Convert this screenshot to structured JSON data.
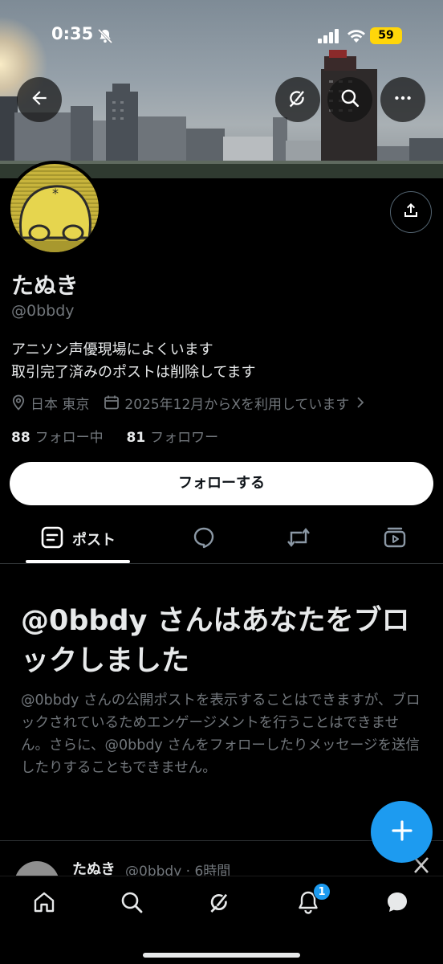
{
  "status_bar": {
    "time": "0:35",
    "battery": "59",
    "icons": [
      "bell-slash-icon",
      "signal-icon",
      "wifi-icon",
      "battery-icon"
    ]
  },
  "banner_buttons": [
    "back-arrow-icon",
    "grok-icon",
    "search-icon",
    "more-icon"
  ],
  "profile": {
    "display_name": "たぬき",
    "handle": "@0bbdy",
    "bio_lines": [
      "アニソン声優現場によくいます",
      "取引完了済みのポストは削除してます"
    ],
    "location": "日本 東京",
    "joined": "2025年12月からXを利用しています",
    "following_count": "88",
    "following_label": "フォロー中",
    "followers_count": "81",
    "followers_label": "フォロワー",
    "follow_button": "フォローする"
  },
  "tabs": [
    {
      "label": "ポスト",
      "icon": "post-icon",
      "active": true
    },
    {
      "label": "",
      "icon": "reply-icon",
      "active": false
    },
    {
      "label": "",
      "icon": "repost-icon",
      "active": false
    },
    {
      "label": "",
      "icon": "media-icon",
      "active": false
    }
  ],
  "blocked_notice": {
    "title": "@0bbdy さんはあなたをブロックしました",
    "description": "@0bbdy さんの公開ポストを表示することはできますが、ブロックされているためエンゲージメントを行うことはできません。さらに、@0bbdy さんをフォローしたりメッセージを送信したりすることもできません。"
  },
  "post_preview": {
    "name": "たぬき",
    "meta": "@0bbdy · 6時間"
  },
  "bottom_nav": {
    "items": [
      "home-icon",
      "search-icon",
      "grok-icon",
      "bell-icon",
      "messages-icon"
    ],
    "notification_badge": "1"
  },
  "colors": {
    "accent": "#1d9bf0",
    "background": "#000000",
    "secondary_text": "#71767b",
    "battery": "#ffd60a"
  }
}
